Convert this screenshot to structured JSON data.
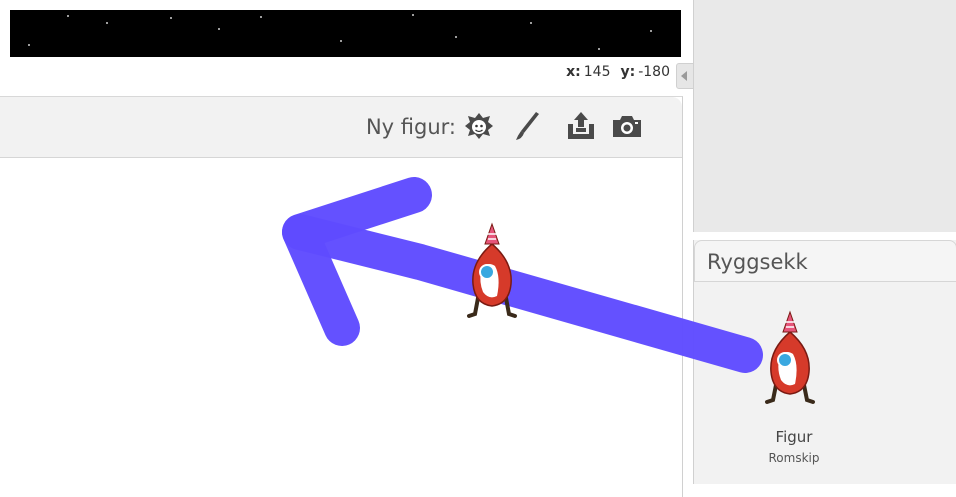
{
  "stage": {
    "coords": {
      "x_label": "x:",
      "x_value": "145",
      "y_label": "y:",
      "y_value": "-180"
    }
  },
  "sprites_panel": {
    "new_sprite_label": "Ny figur:",
    "tools": [
      {
        "name": "choose-from-library",
        "icon": "sprite-head-icon"
      },
      {
        "name": "paint-new",
        "icon": "paintbrush-icon"
      },
      {
        "name": "upload-from-file",
        "icon": "upload-icon"
      },
      {
        "name": "new-from-camera",
        "icon": "camera-icon"
      }
    ]
  },
  "backpack": {
    "title": "Ryggsekk",
    "items": [
      {
        "name": "Figur",
        "costume": "Romskip"
      }
    ]
  },
  "colors": {
    "drag_arrow": "#5f4bff",
    "rocket_body": "#d63a2a",
    "rocket_window": "#3aa8e0"
  }
}
